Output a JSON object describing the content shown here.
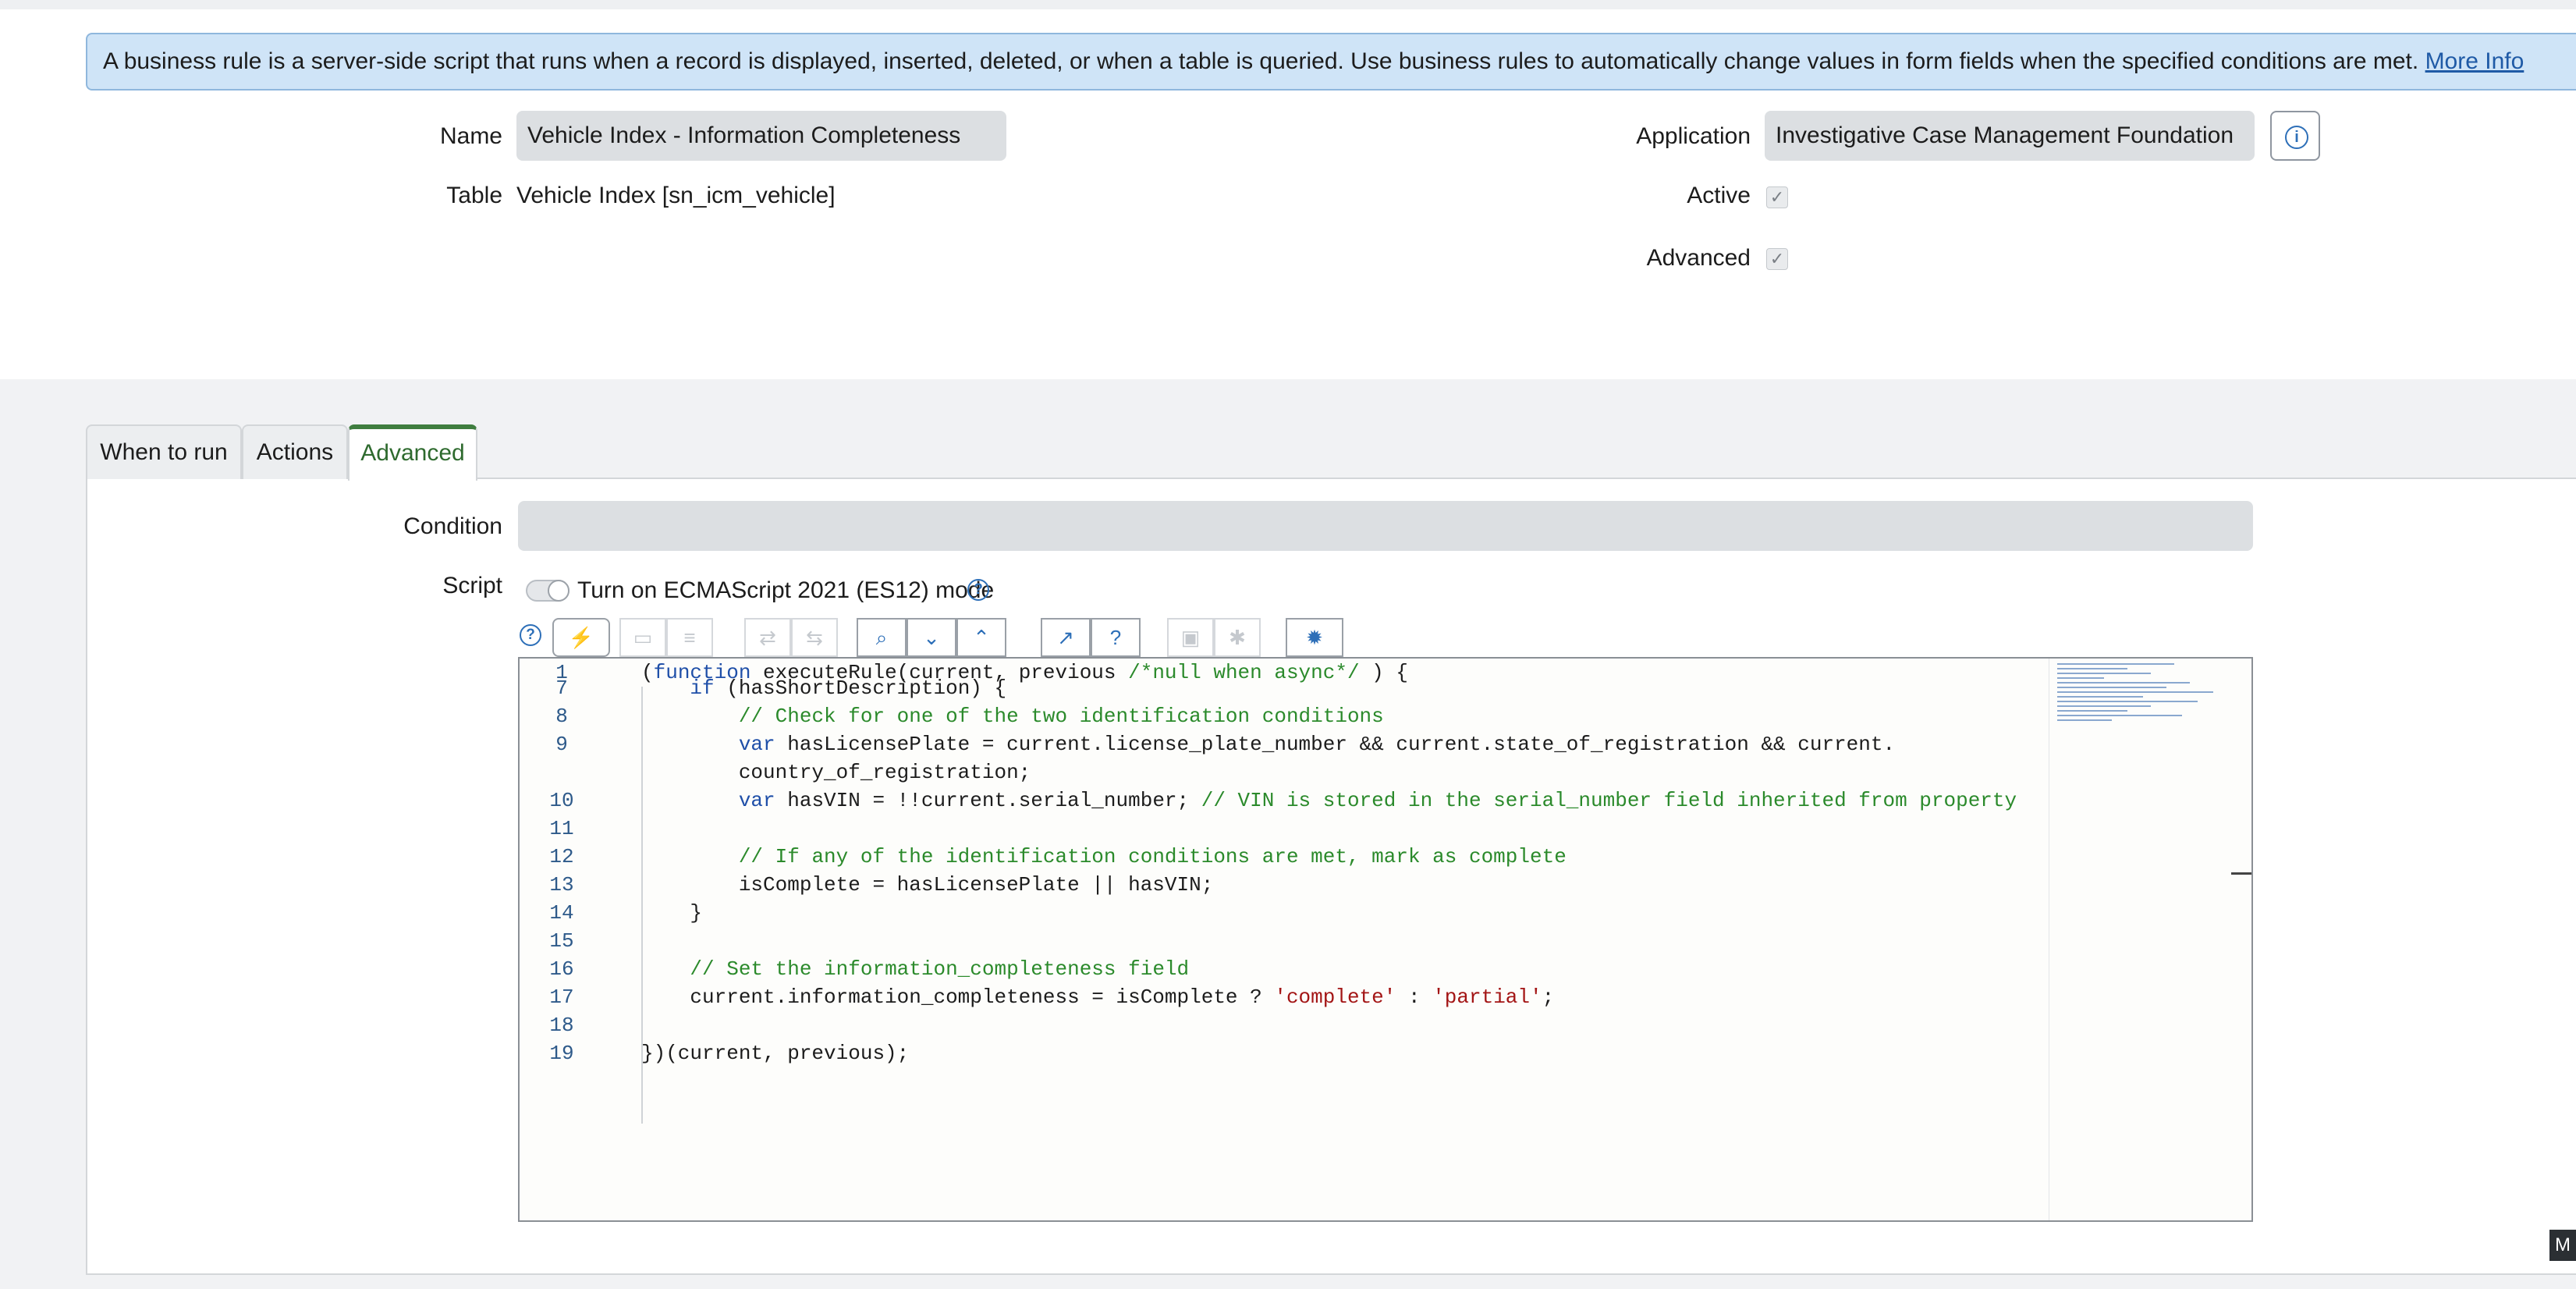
{
  "banner": {
    "text": "A business rule is a server-side script that runs when a record is displayed, inserted, deleted, or when a table is queried. Use business rules to automatically change values in form fields when the specified conditions are met. ",
    "link": "More Info"
  },
  "form": {
    "name_label": "Name",
    "name_value": "Vehicle Index - Information Completeness",
    "table_label": "Table",
    "table_value": "Vehicle Index [sn_icm_vehicle]",
    "application_label": "Application",
    "application_value": "Investigative Case Management Foundation",
    "active_label": "Active",
    "active_checked": true,
    "advanced_label": "Advanced",
    "advanced_checked": true
  },
  "tabs": [
    {
      "label": "When to run",
      "active": false
    },
    {
      "label": "Actions",
      "active": false
    },
    {
      "label": "Advanced",
      "active": true
    }
  ],
  "advanced": {
    "condition_label": "Condition",
    "condition_value": "",
    "script_label": "Script",
    "es_mode_label": "Turn on ECMAScript 2021 (ES12) mode"
  },
  "toolbar": {
    "buttons": [
      {
        "name": "help",
        "icon": "help-icon"
      },
      {
        "name": "toggle-syntax",
        "icon": "syntax-toggle-icon"
      },
      {
        "name": "comment",
        "icon": "comment-icon",
        "disabled": true
      },
      {
        "name": "format",
        "icon": "format-code-icon",
        "disabled": true
      },
      {
        "name": "replace",
        "icon": "replace-icon",
        "disabled": true
      },
      {
        "name": "replace-all",
        "icon": "replace-all-icon",
        "disabled": true
      },
      {
        "name": "search",
        "icon": "search-icon"
      },
      {
        "name": "next",
        "icon": "chevron-down-icon"
      },
      {
        "name": "previous",
        "icon": "chevron-up-icon"
      },
      {
        "name": "fullscreen",
        "icon": "expand-icon"
      },
      {
        "name": "script-help",
        "icon": "question-icon"
      },
      {
        "name": "save",
        "icon": "save-icon",
        "disabled": true
      },
      {
        "name": "debug",
        "icon": "debug-icon",
        "disabled": true
      },
      {
        "name": "script-debugger",
        "icon": "bug-icon"
      }
    ]
  },
  "code": {
    "lines": [
      {
        "n": "1",
        "html": "(function executeRule(current, previous /*null when async*/ ) {"
      },
      {
        "n": "7",
        "html": "    if (hasShortDescription) {"
      },
      {
        "n": "8",
        "html": "        // Check for one of the two identification conditions"
      },
      {
        "n": "9",
        "html": "        var hasLicensePlate = current.license_plate_number && current.state_of_registration && current."
      },
      {
        "n": "",
        "html": "        country_of_registration;"
      },
      {
        "n": "10",
        "html": "        var hasVIN = !!current.serial_number; // VIN is stored in the serial_number field inherited from property"
      },
      {
        "n": "11",
        "html": ""
      },
      {
        "n": "12",
        "html": "        // If any of the identification conditions are met, mark as complete"
      },
      {
        "n": "13",
        "html": "        isComplete = hasLicensePlate || hasVIN;"
      },
      {
        "n": "14",
        "html": "    }"
      },
      {
        "n": "15",
        "html": ""
      },
      {
        "n": "16",
        "html": "    // Set the information_completeness field"
      },
      {
        "n": "17",
        "html": "    current.information_completeness = isComplete ? 'complete' : 'partial';"
      },
      {
        "n": "18",
        "html": ""
      },
      {
        "n": "19",
        "html": "})(current, previous);"
      }
    ]
  },
  "corner_badge": "M"
}
